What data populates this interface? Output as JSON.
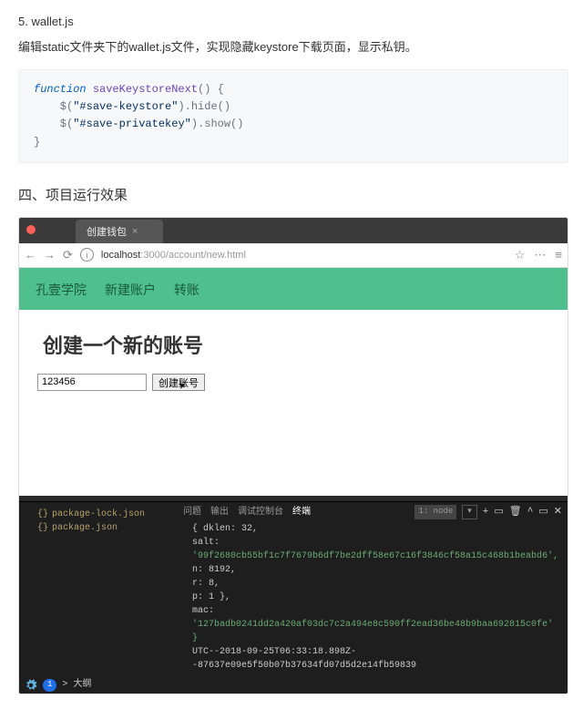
{
  "doc": {
    "step_label": "5. wallet.js",
    "description": "编辑static文件夹下的wallet.js文件，实现隐藏keystore下载页面，显示私钥。",
    "section_heading": "四、项目运行效果",
    "code": {
      "kw_function": "function",
      "fn_name": "saveKeystoreNext",
      "parens": "() {",
      "line2a": "    $(",
      "line2b": "\"#save-keystore\"",
      "line2c": ").hide()",
      "line3a": "    $(",
      "line3b": "\"#save-privatekey\"",
      "line3c": ").show()",
      "closing": "}"
    }
  },
  "browser": {
    "tab_title": "创建钱包",
    "nav_back": "←",
    "nav_fwd": "→",
    "nav_reload": "⟳",
    "info": "i",
    "url_host": "localhost",
    "url_port_path": ":3000/account/new.html",
    "star": "☆",
    "more_icon": "⋯",
    "menu_icon": "≡"
  },
  "page": {
    "nav_items": [
      "孔壹学院",
      "新建账户",
      "转账"
    ],
    "heading": "创建一个新的账号",
    "password_value": "123456",
    "create_btn": "创建账号"
  },
  "devtools": {
    "left_files": [
      "package-lock.json",
      "package.json"
    ],
    "tabs": [
      "问题",
      "输出",
      "调试控制台",
      "终端"
    ],
    "active_tab_index": 3,
    "runner_label": "1: node",
    "ctrls": [
      "+",
      "▭",
      "🗑",
      "^",
      "▭",
      "✕"
    ],
    "output_lines": [
      "{ dklen: 32,",
      "salt: '99f2680cb55bf1c7f7679b6df7be2dff58e67c16f3846cf58a15c468b1beabd6',",
      "n: 8192,",
      "r: 8,",
      "p: 1 },",
      "mac: '127badb0241dd2a420af03dc7c2a494e8c590ff2ead36be48b9baa692815c0fe' }",
      "UTC--2018-09-25T06:33:18.898Z--87637e09e5f50b07b37634fd07d5d2e14fb59839"
    ],
    "bottom_badge_count": "1",
    "bottom_label": "大纲"
  }
}
